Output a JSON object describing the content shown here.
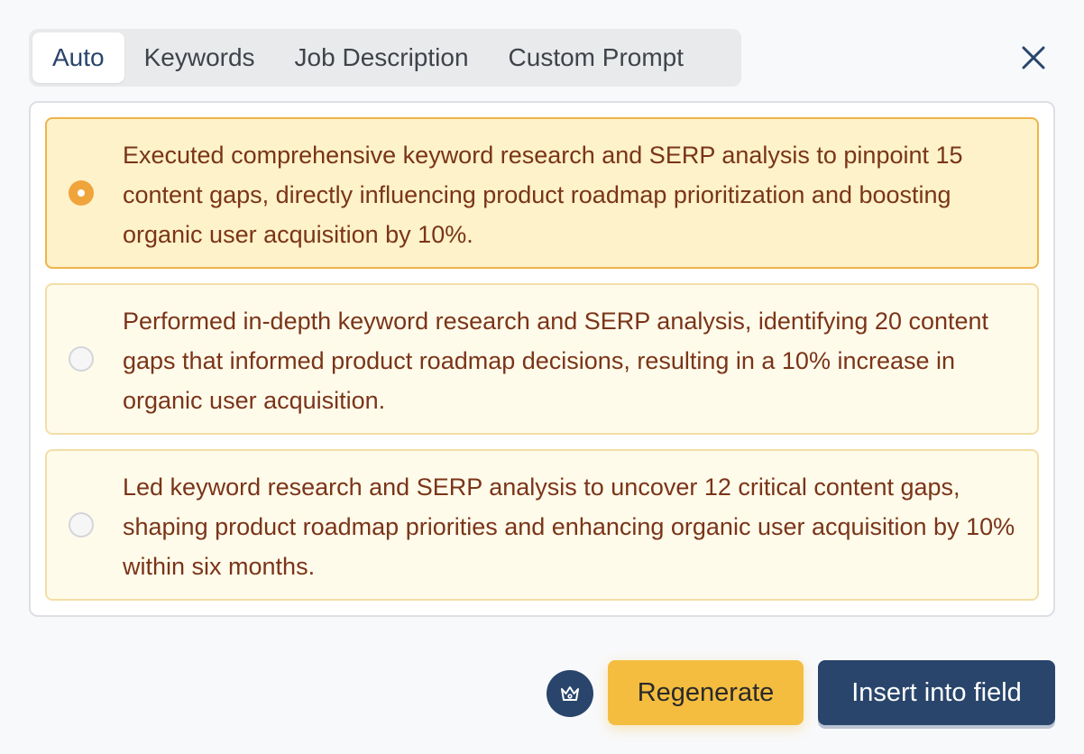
{
  "tabs": [
    {
      "label": "Auto",
      "active": true
    },
    {
      "label": "Keywords",
      "active": false
    },
    {
      "label": "Job Description",
      "active": false
    },
    {
      "label": "Custom Prompt",
      "active": false
    }
  ],
  "options": [
    {
      "text": "Executed comprehensive keyword research and SERP analysis to pinpoint 15 content gaps, directly influencing product roadmap prioritization and boosting organic user acquisition by 10%.",
      "selected": true
    },
    {
      "text": "Performed in-depth keyword research and SERP analysis, identifying 20 content gaps that informed product roadmap decisions, resulting in a 10% increase in organic user acquisition.",
      "selected": false
    },
    {
      "text": "Led keyword research and SERP analysis to uncover 12 critical content gaps, shaping product roadmap priorities and enhancing organic user acquisition by 10% within six months.",
      "selected": false
    }
  ],
  "actions": {
    "premium_icon": "crown-icon",
    "regenerate_label": "Regenerate",
    "insert_label": "Insert into field"
  },
  "icons": {
    "close": "close-icon"
  },
  "colors": {
    "accent": "#29456b",
    "highlight": "#f4bd3f",
    "option_text": "#7a3419",
    "selected_bg": "#fdf2c9",
    "radio_on": "#f0a43c"
  }
}
